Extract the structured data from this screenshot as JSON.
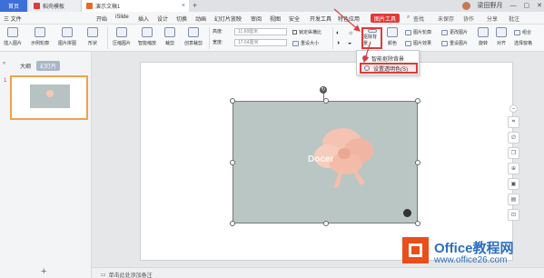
{
  "tabs": [
    {
      "label": "首页"
    },
    {
      "label": "稻壳模板"
    },
    {
      "label": "演示文稿1"
    }
  ],
  "window": {
    "user_name": "梁田野月"
  },
  "menu": {
    "file": "三 文件",
    "items": [
      "开始",
      "iSlide",
      "插入",
      "设计",
      "切换",
      "动画",
      "幻灯片放映",
      "审阅",
      "视图",
      "安全",
      "开发工具",
      "特色应用"
    ],
    "picture_tools": "图片工具",
    "search": "查找",
    "save_status": "未保存",
    "collab": "协作",
    "share": "分享",
    "comment": "批注"
  },
  "ribbon": {
    "insert_picture": "插入图片",
    "picture_outline": "示例轮廓",
    "picture_crop": "图片拼图",
    "shape": "形状",
    "compress": "压缩图片",
    "smart_zoom": "智能缩放",
    "crop": "裁剪",
    "crop_shape": "创意裁剪",
    "height_label": "高度:",
    "height_value": "11.68厘米",
    "width_label": "宽度:",
    "width_value": "17.64厘米",
    "lock_ratio": "锁定纵横比",
    "reset_size": "重设大小",
    "matting": "抠除背景",
    "color": "颜色",
    "picture_outline2": "图片轮廓",
    "picture_effect": "图片效果",
    "change_picture": "更改图片",
    "reset_picture": "重设图片",
    "rotate": "旋转",
    "align": "对齐",
    "combine": "组合",
    "selection_pane": "选择窗格"
  },
  "dropdown": {
    "items": [
      {
        "label": "智能抠除背景"
      },
      {
        "label": "设置透明色(S)"
      }
    ]
  },
  "left_panel": {
    "outline_tab": "大纲",
    "slides_tab": "幻灯片",
    "slide_number": "1"
  },
  "canvas": {
    "picture_watermark": "Docer",
    "rotate_glyph": "↻"
  },
  "notes": {
    "placeholder": "单击此处添加备注"
  },
  "watermark": {
    "title": "Office教程网",
    "url": "www.office26.com"
  },
  "colors": {
    "accent_red": "#e03a3a",
    "tab_blue": "#3d6fd8",
    "logo_orange": "#e94e1b",
    "logo_blue": "#2c6fc0"
  }
}
